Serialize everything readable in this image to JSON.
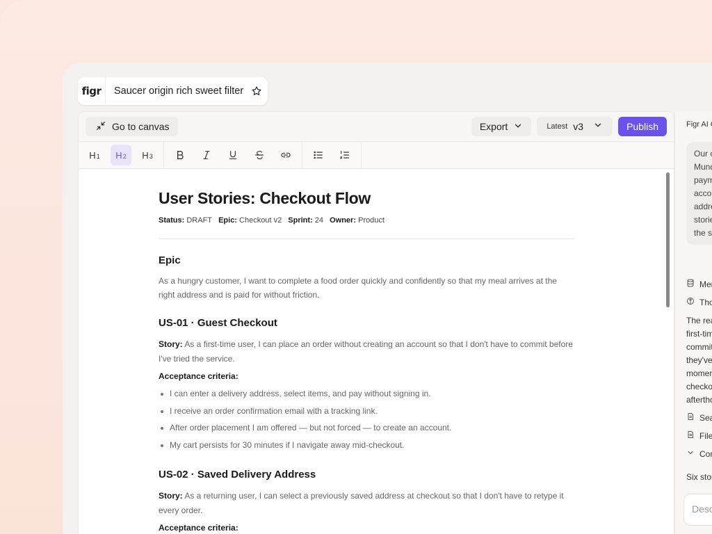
{
  "app": {
    "logo": "figr",
    "file_name": "Saucer origin rich sweet filter"
  },
  "toolbar": {
    "goto_canvas": "Go to canvas",
    "export": "Export",
    "version_label": "Latest",
    "version": "v3",
    "publish": "Publish",
    "accent": "#6b52e8"
  },
  "format": {
    "h1": "H",
    "h1_sub": "1",
    "h2": "H",
    "h2_sub": "2",
    "h3": "H",
    "h3_sub": "3",
    "active": "h2"
  },
  "doc": {
    "title": "User Stories: Checkout Flow",
    "meta": {
      "status_label": "Status:",
      "status": "DRAFT",
      "epic_label": "Epic:",
      "epic": "Checkout v2",
      "sprint_label": "Sprint:",
      "sprint": "24",
      "owner_label": "Owner:",
      "owner": "Product"
    },
    "epic_heading": "Epic",
    "epic_text": "As a hungry customer, I want to complete a food order quickly and confidently so that my meal arrives at the right address and is paid for without friction.",
    "us01": {
      "heading": "US-01 · Guest Checkout",
      "story_label": "Story:",
      "story": "As a first-time user, I can place an order without creating an account so that I don't have to commit before I've tried the service.",
      "ac_label": "Acceptance criteria:",
      "criteria": [
        "I can enter a delivery address, select items, and pay without signing in.",
        "I receive an order confirmation email with a tracking link.",
        "After order placement I am offered — but not forced — to create an account.",
        "My cart persists for 30 minutes if I navigate away mid-checkout."
      ]
    },
    "us02": {
      "heading": "US-02 · Saved Delivery Address",
      "story_label": "Story:",
      "story": "As a returning user, I can select a previously saved address at checkout so that I don't have to retype it every order.",
      "ac_label": "Acceptance criteria:"
    }
  },
  "assistant": {
    "title": "Figr AI C",
    "bubble_lines": [
      "Our c",
      "Mund",
      "paym",
      "accou",
      "addre",
      "storie",
      "the s"
    ],
    "row_memory": "Mer",
    "row_thought": "Tho",
    "reply_lines": [
      "The rea",
      "first-tim",
      "commit",
      "they've",
      "momen",
      "checko",
      "afterthc"
    ],
    "row_search": "Sea",
    "row_files": "File",
    "row_collapse": "Con",
    "summary": "Six stor",
    "input_placeholder": "Desc"
  }
}
